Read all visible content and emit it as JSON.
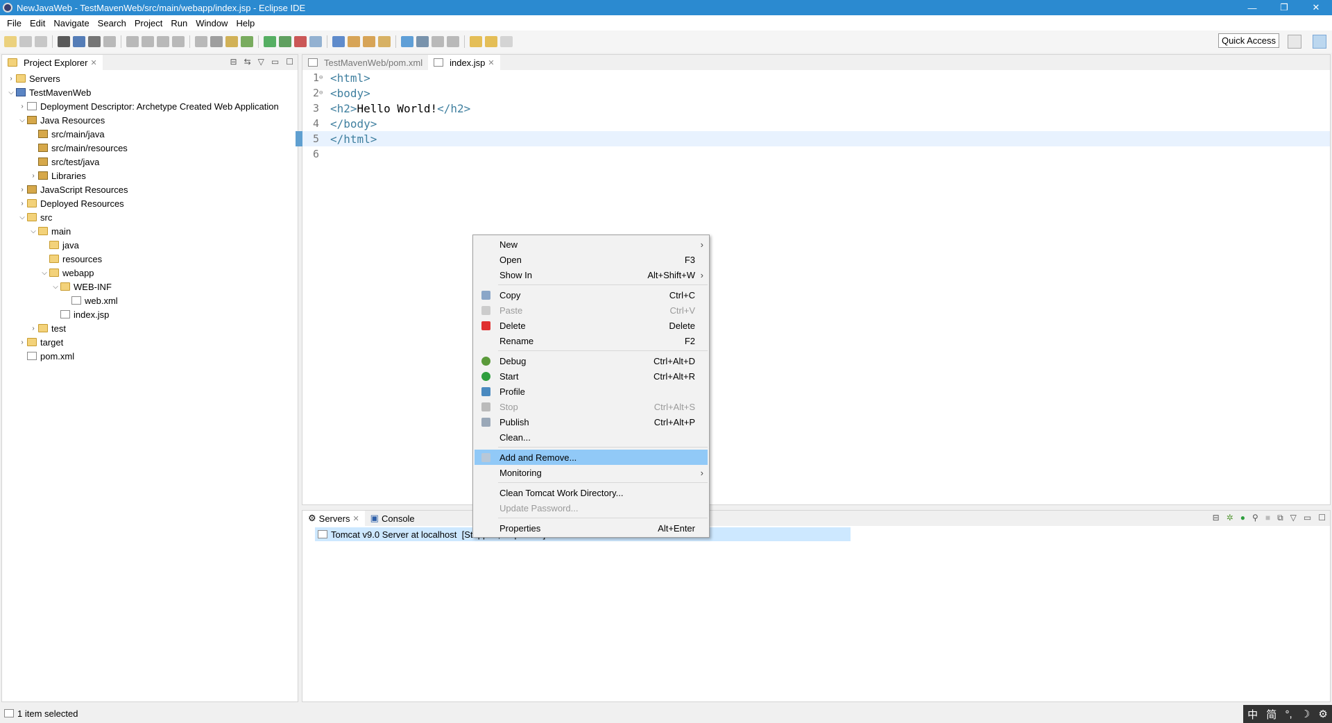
{
  "title": "NewJavaWeb - TestMavenWeb/src/main/webapp/index.jsp - Eclipse IDE",
  "window_buttons": [
    "minimize",
    "restore",
    "close"
  ],
  "menubar": [
    "File",
    "Edit",
    "Navigate",
    "Search",
    "Project",
    "Run",
    "Window",
    "Help"
  ],
  "quick_access": "Quick Access",
  "project_explorer": {
    "title": "Project Explorer",
    "items": [
      {
        "label": "Servers",
        "depth": 0,
        "arrow": ">",
        "icon": "folder"
      },
      {
        "label": "TestMavenWeb",
        "depth": 0,
        "arrow": "v",
        "icon": "proj"
      },
      {
        "label": "Deployment Descriptor: Archetype Created Web Application",
        "depth": 1,
        "arrow": ">",
        "icon": "file"
      },
      {
        "label": "Java Resources",
        "depth": 1,
        "arrow": "v",
        "icon": "pkg"
      },
      {
        "label": "src/main/java",
        "depth": 2,
        "arrow": "",
        "icon": "pkg"
      },
      {
        "label": "src/main/resources",
        "depth": 2,
        "arrow": "",
        "icon": "pkg"
      },
      {
        "label": "src/test/java",
        "depth": 2,
        "arrow": "",
        "icon": "pkg"
      },
      {
        "label": "Libraries",
        "depth": 2,
        "arrow": ">",
        "icon": "pkg"
      },
      {
        "label": "JavaScript Resources",
        "depth": 1,
        "arrow": ">",
        "icon": "pkg"
      },
      {
        "label": "Deployed Resources",
        "depth": 1,
        "arrow": ">",
        "icon": "folder"
      },
      {
        "label": "src",
        "depth": 1,
        "arrow": "v",
        "icon": "folder"
      },
      {
        "label": "main",
        "depth": 2,
        "arrow": "v",
        "icon": "folder"
      },
      {
        "label": "java",
        "depth": 3,
        "arrow": "",
        "icon": "folder"
      },
      {
        "label": "resources",
        "depth": 3,
        "arrow": "",
        "icon": "folder"
      },
      {
        "label": "webapp",
        "depth": 3,
        "arrow": "v",
        "icon": "folder"
      },
      {
        "label": "WEB-INF",
        "depth": 4,
        "arrow": "v",
        "icon": "folder"
      },
      {
        "label": "web.xml",
        "depth": 5,
        "arrow": "",
        "icon": "file"
      },
      {
        "label": "index.jsp",
        "depth": 4,
        "arrow": "",
        "icon": "file"
      },
      {
        "label": "test",
        "depth": 2,
        "arrow": ">",
        "icon": "folder"
      },
      {
        "label": "target",
        "depth": 1,
        "arrow": ">",
        "icon": "folder"
      },
      {
        "label": "pom.xml",
        "depth": 1,
        "arrow": "",
        "icon": "file"
      }
    ]
  },
  "editor": {
    "tabs": [
      {
        "label": "TestMavenWeb/pom.xml",
        "active": false
      },
      {
        "label": "index.jsp",
        "active": true
      }
    ],
    "lines": [
      {
        "n": "1",
        "fold": "⊖",
        "parts": [
          [
            "tag",
            "<html>"
          ]
        ]
      },
      {
        "n": "2",
        "fold": "⊖",
        "parts": [
          [
            "tag",
            "<body>"
          ]
        ]
      },
      {
        "n": "3",
        "fold": "",
        "parts": [
          [
            "tag",
            "<h2>"
          ],
          [
            "txt",
            "Hello World!"
          ],
          [
            "tag",
            "</h2>"
          ]
        ]
      },
      {
        "n": "4",
        "fold": "",
        "parts": [
          [
            "tag",
            "</body>"
          ]
        ]
      },
      {
        "n": "5",
        "fold": "",
        "parts": [
          [
            "tag",
            "</html>"
          ]
        ],
        "current": true
      },
      {
        "n": "6",
        "fold": "",
        "parts": []
      }
    ]
  },
  "bottom": {
    "tabs": [
      "Servers",
      "Console"
    ],
    "server": "Tomcat v9.0 Server at localhost",
    "server_status": "[Stopped, Republish]"
  },
  "context_menu": [
    {
      "label": "New",
      "shortcut": "",
      "sub": true
    },
    {
      "label": "Open",
      "shortcut": "F3"
    },
    {
      "label": "Show In",
      "shortcut": "Alt+Shift+W",
      "sub": true
    },
    {
      "sep": true
    },
    {
      "label": "Copy",
      "shortcut": "Ctrl+C",
      "icon": "copy",
      "color": "#8aa6c8"
    },
    {
      "label": "Paste",
      "shortcut": "Ctrl+V",
      "icon": "paste",
      "disabled": true,
      "color": "#cccccc"
    },
    {
      "label": "Delete",
      "shortcut": "Delete",
      "icon": "delete",
      "color": "#e03030"
    },
    {
      "label": "Rename",
      "shortcut": "F2"
    },
    {
      "sep": true
    },
    {
      "label": "Debug",
      "shortcut": "Ctrl+Alt+D",
      "icon": "debug",
      "color": "#5a9a3a"
    },
    {
      "label": "Start",
      "shortcut": "Ctrl+Alt+R",
      "icon": "start",
      "color": "#2e9e3e"
    },
    {
      "label": "Profile",
      "shortcut": "",
      "icon": "profile",
      "color": "#4a8ac0"
    },
    {
      "label": "Stop",
      "shortcut": "Ctrl+Alt+S",
      "icon": "stop",
      "disabled": true,
      "color": "#bbbbbb"
    },
    {
      "label": "Publish",
      "shortcut": "Ctrl+Alt+P",
      "icon": "publish",
      "color": "#9aa8b8"
    },
    {
      "label": "Clean...",
      "shortcut": ""
    },
    {
      "sep": true
    },
    {
      "label": "Add and Remove...",
      "shortcut": "",
      "icon": "add-remove",
      "highlight": true,
      "color": "#b8c8d8"
    },
    {
      "label": "Monitoring",
      "shortcut": "",
      "sub": true
    },
    {
      "sep": true
    },
    {
      "label": "Clean Tomcat Work Directory...",
      "shortcut": ""
    },
    {
      "label": "Update Password...",
      "shortcut": "",
      "disabled": true
    },
    {
      "sep": true
    },
    {
      "label": "Properties",
      "shortcut": "Alt+Enter"
    }
  ],
  "status": "1 item selected",
  "ime": [
    "中",
    "简",
    "°,",
    "☽",
    "⚙"
  ]
}
